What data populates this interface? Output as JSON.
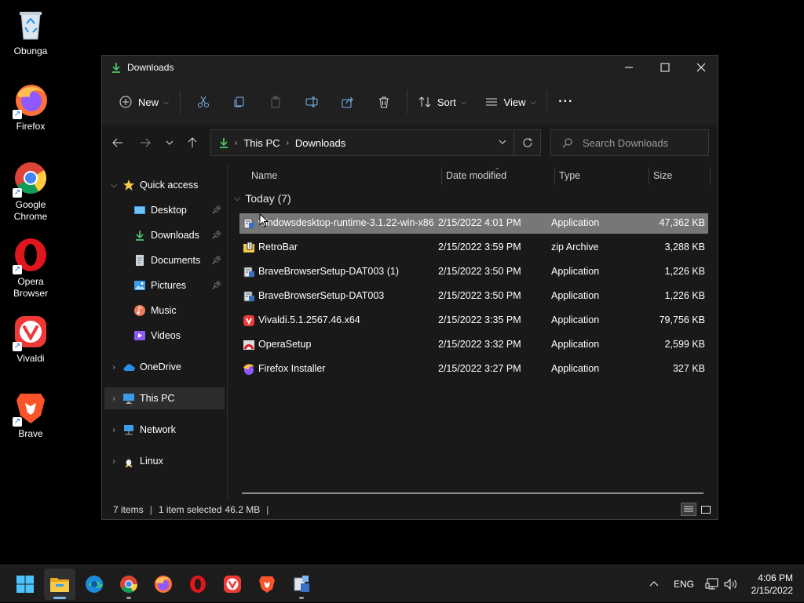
{
  "desktop": {
    "icons": [
      {
        "label": "Obunga",
        "icon": "recycle-bin-icon"
      },
      {
        "label": "Firefox",
        "icon": "firefox-icon"
      },
      {
        "label": "Google Chrome",
        "icon": "chrome-icon"
      },
      {
        "label": "Opera Browser",
        "icon": "opera-icon"
      },
      {
        "label": "Vivaldi",
        "icon": "vivaldi-icon"
      },
      {
        "label": "Brave",
        "icon": "brave-icon"
      }
    ]
  },
  "window": {
    "title": "Downloads",
    "toolbar": {
      "new_label": "New",
      "sort_label": "Sort",
      "view_label": "View",
      "more_label": "···"
    },
    "address": {
      "crumbs": [
        "This PC",
        "Downloads"
      ],
      "search_placeholder": "Search Downloads"
    },
    "nav": {
      "quick_access": "Quick access",
      "items": [
        {
          "label": "Desktop",
          "pinned": true
        },
        {
          "label": "Downloads",
          "pinned": true
        },
        {
          "label": "Documents",
          "pinned": true
        },
        {
          "label": "Pictures",
          "pinned": true
        },
        {
          "label": "Music",
          "pinned": false
        },
        {
          "label": "Videos",
          "pinned": false
        }
      ],
      "onedrive": "OneDrive",
      "this_pc": "This PC",
      "network": "Network",
      "linux": "Linux"
    },
    "columns": {
      "name": "Name",
      "date": "Date modified",
      "type": "Type",
      "size": "Size"
    },
    "group_label": "Today (7)",
    "files": [
      {
        "name": "windowsdesktop-runtime-3.1.22-win-x86",
        "date": "2/15/2022 4:01 PM",
        "type": "Application",
        "size": "47,362 KB",
        "icon": "installer-icon",
        "selected": true
      },
      {
        "name": "RetroBar",
        "date": "2/15/2022 3:59 PM",
        "type": "zip Archive",
        "size": "3,288 KB",
        "icon": "zip-archive-icon",
        "selected": false
      },
      {
        "name": "BraveBrowserSetup-DAT003 (1)",
        "date": "2/15/2022 3:50 PM",
        "type": "Application",
        "size": "1,226 KB",
        "icon": "installer-icon",
        "selected": false
      },
      {
        "name": "BraveBrowserSetup-DAT003",
        "date": "2/15/2022 3:50 PM",
        "type": "Application",
        "size": "1,226 KB",
        "icon": "installer-icon",
        "selected": false
      },
      {
        "name": "Vivaldi.5.1.2567.46.x64",
        "date": "2/15/2022 3:35 PM",
        "type": "Application",
        "size": "79,756 KB",
        "icon": "vivaldi-icon",
        "selected": false
      },
      {
        "name": "OperaSetup",
        "date": "2/15/2022 3:32 PM",
        "type": "Application",
        "size": "2,599 KB",
        "icon": "opera-setup-icon",
        "selected": false
      },
      {
        "name": "Firefox Installer",
        "date": "2/15/2022 3:27 PM",
        "type": "Application",
        "size": "327 KB",
        "icon": "firefox-icon",
        "selected": false
      }
    ],
    "status": {
      "items": "7 items",
      "selected": "1 item selected",
      "size": "46.2 MB"
    }
  },
  "taskbar": {
    "language": "ENG",
    "time": "4:06 PM",
    "date": "2/15/2022"
  },
  "colors": {
    "accent_green": "#4cc26a",
    "folder_yellow": "#f7c948",
    "selection": "#777777"
  }
}
